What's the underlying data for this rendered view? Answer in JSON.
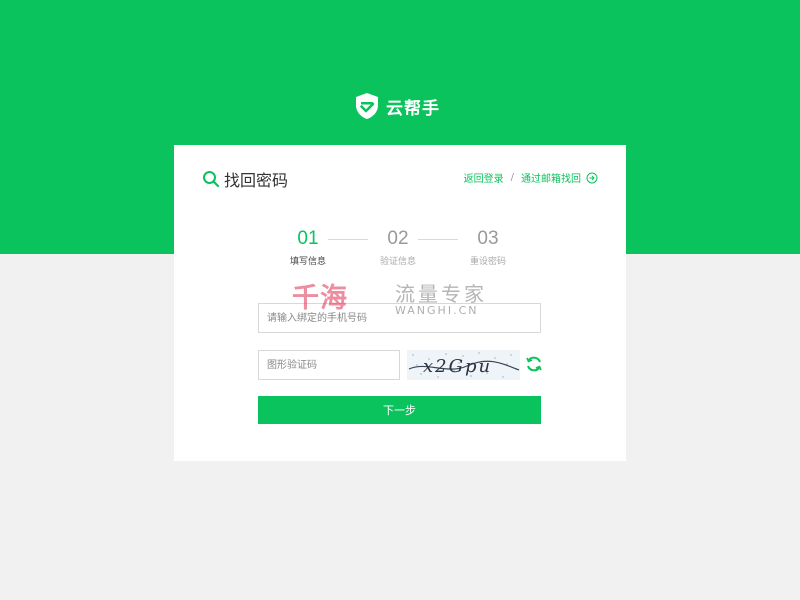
{
  "brand": {
    "logo_icon": "shield-check-icon",
    "name": "云帮手",
    "primary_color": "#0ac35d"
  },
  "card": {
    "title": "找回密码",
    "title_icon": "search-icon",
    "links": {
      "back_to_login": "返回登录",
      "separator": "/",
      "find_by_email": "通过邮箱找回",
      "find_by_email_icon": "arrow-circle-right-icon"
    }
  },
  "steps": [
    {
      "number": "01",
      "label": "填写信息",
      "active": true
    },
    {
      "number": "02",
      "label": "验证信息",
      "active": false
    },
    {
      "number": "03",
      "label": "重设密码",
      "active": false
    }
  ],
  "form": {
    "phone": {
      "placeholder": "请输入绑定的手机号码",
      "value": ""
    },
    "captcha": {
      "placeholder": "图形验证码",
      "value": ""
    },
    "captcha_image_text": "x2Gpu",
    "refresh_icon": "refresh-icon",
    "next_label": "下一步"
  },
  "watermark": {
    "logo_text": "千海",
    "slogan": "流量专家",
    "domain": "WANGHI.CN"
  }
}
